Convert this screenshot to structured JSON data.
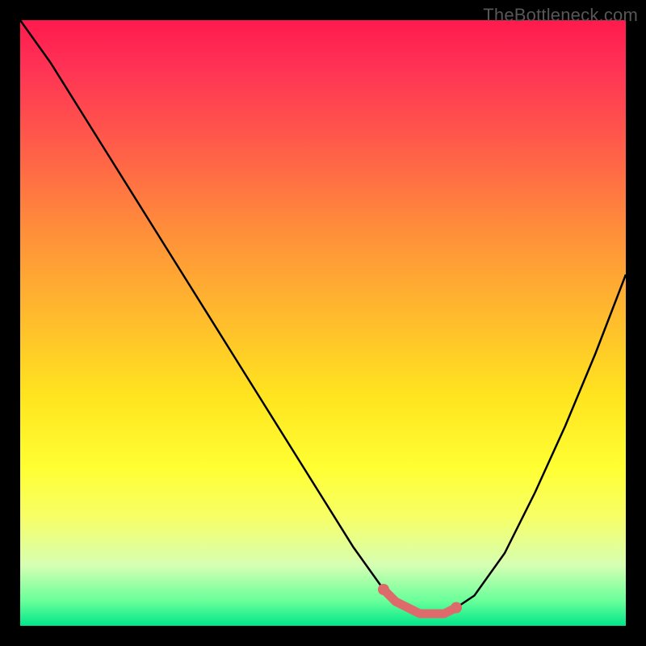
{
  "attribution": "TheBottleneck.com",
  "chart_data": {
    "type": "line",
    "title": "",
    "xlabel": "",
    "ylabel": "",
    "xlim": [
      0,
      100
    ],
    "ylim": [
      0,
      100
    ],
    "series": [
      {
        "name": "bottleneck-curve",
        "x": [
          0,
          5,
          10,
          15,
          20,
          25,
          30,
          35,
          40,
          45,
          50,
          55,
          60,
          62,
          64,
          66,
          68,
          70,
          72,
          75,
          80,
          85,
          90,
          95,
          100
        ],
        "y": [
          100,
          93,
          85,
          77,
          69,
          61,
          53,
          45,
          37,
          29,
          21,
          13,
          6,
          4,
          3,
          2,
          2,
          2,
          3,
          5,
          12,
          22,
          33,
          45,
          58
        ]
      }
    ],
    "marker_band": {
      "name": "optimal-range",
      "x": [
        60,
        62,
        64,
        66,
        68,
        70,
        72
      ],
      "y": [
        6,
        4,
        3,
        2,
        2,
        2,
        3
      ]
    },
    "background_gradient": {
      "stops": [
        {
          "pos": 0.0,
          "color": "#ff1a4d"
        },
        {
          "pos": 0.08,
          "color": "#ff3355"
        },
        {
          "pos": 0.2,
          "color": "#ff5a4a"
        },
        {
          "pos": 0.35,
          "color": "#ff8f3a"
        },
        {
          "pos": 0.48,
          "color": "#ffb82e"
        },
        {
          "pos": 0.62,
          "color": "#ffe41f"
        },
        {
          "pos": 0.74,
          "color": "#ffff33"
        },
        {
          "pos": 0.82,
          "color": "#f7ff66"
        },
        {
          "pos": 0.9,
          "color": "#d6ffb3"
        },
        {
          "pos": 0.96,
          "color": "#66ff99"
        },
        {
          "pos": 1.0,
          "color": "#00e68a"
        }
      ]
    },
    "colors": {
      "curve": "#000000",
      "marker": "#dd6b6b",
      "frame": "#000000"
    }
  }
}
